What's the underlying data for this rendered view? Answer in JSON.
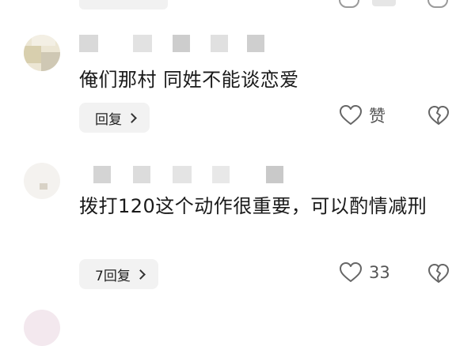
{
  "comments": [
    {
      "text": "俺们那村 同姓不能谈恋爱",
      "reply_label": "回复",
      "like_label": "赞",
      "like_icon": "heart-outline-icon",
      "dislike_icon": "broken-heart-icon"
    },
    {
      "text": "拨打120这个动作很重要，可以酌情减刑",
      "reply_label": "7回复",
      "like_label": "33",
      "like_icon": "heart-outline-icon",
      "dislike_icon": "broken-heart-icon"
    }
  ],
  "colors": {
    "icon_stroke": "#666666",
    "reply_bg": "#f2f2f2",
    "name_blur": "#d9d9d9"
  }
}
